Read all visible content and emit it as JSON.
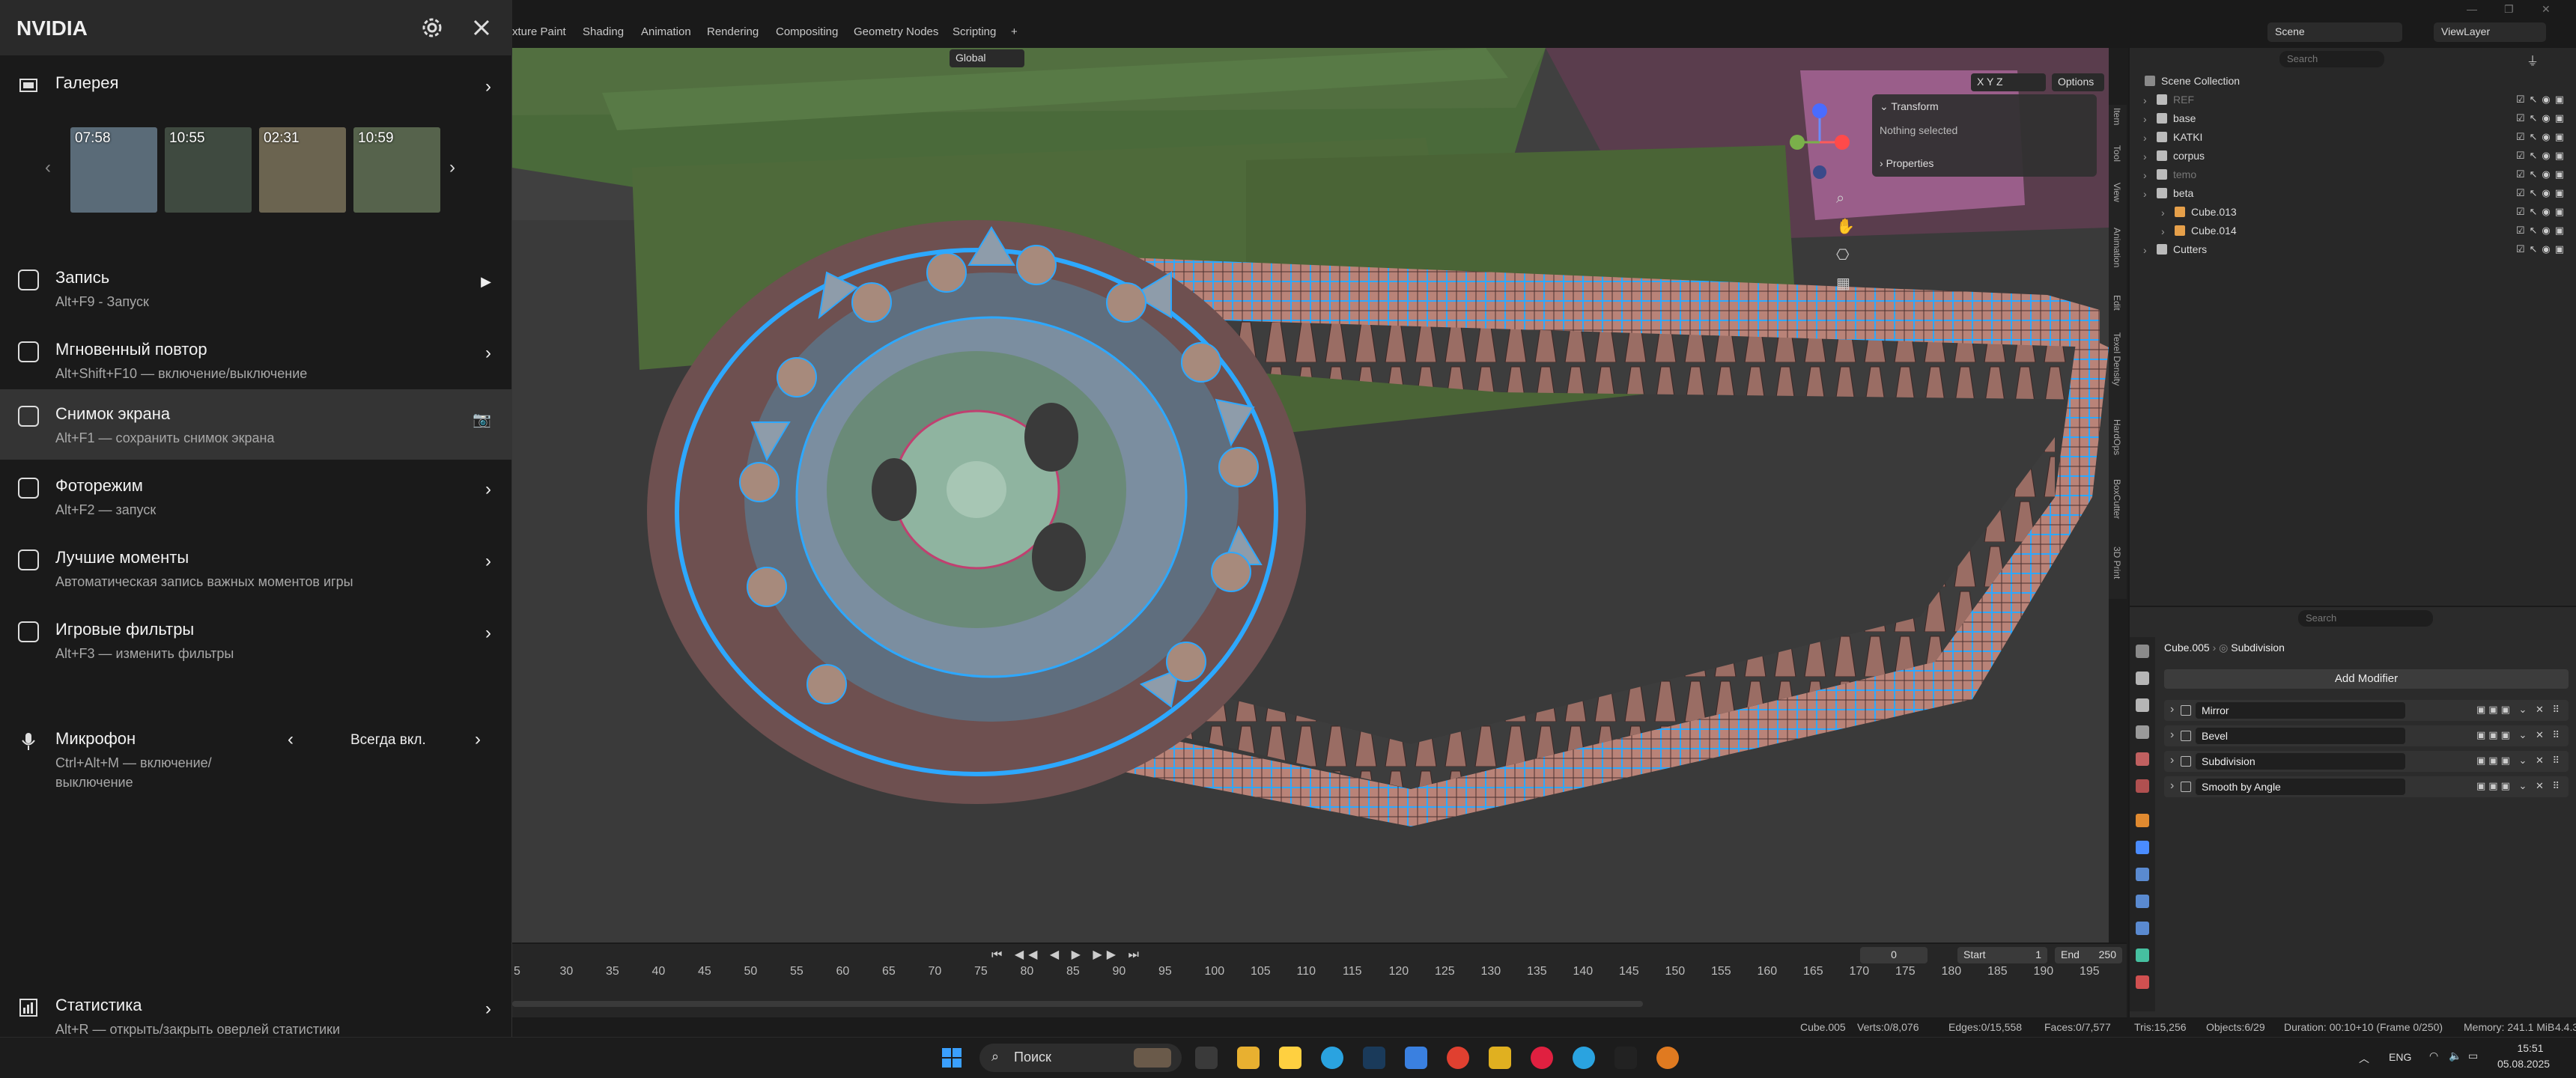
{
  "nvidia": {
    "title": "NVIDIA",
    "gallery": {
      "label": "Галерея",
      "thumbnails": [
        {
          "time": "07:58",
          "color": "#5a6b78"
        },
        {
          "time": "10:55",
          "color": "#3f4a40"
        },
        {
          "time": "02:31",
          "color": "#6b6450"
        },
        {
          "time": "10:59",
          "color": "#56634c"
        }
      ]
    },
    "items": [
      {
        "key": "record",
        "label": "Запись",
        "sub": "Alt+F9 - Запуск",
        "icon": "record-icon",
        "arrow": "▶"
      },
      {
        "key": "replay",
        "label": "Мгновенный повтор",
        "sub": "Alt+Shift+F10 — включение/выключение",
        "icon": "instant-replay-icon",
        "arrow": "›"
      },
      {
        "key": "screenshot",
        "label": "Снимок экрана",
        "sub": "Alt+F1 — сохранить снимок экрана",
        "icon": "screenshot-icon",
        "arrow": "camera"
      },
      {
        "key": "photo",
        "label": "Фоторежим",
        "sub": "Alt+F2 — запуск",
        "icon": "photo-mode-icon",
        "arrow": "›"
      },
      {
        "key": "highlights",
        "label": "Лучшие моменты",
        "sub": "Автоматическая запись важных моментов игры",
        "icon": "highlights-icon",
        "arrow": "›"
      },
      {
        "key": "filters",
        "label": "Игровые фильтры",
        "sub": "Alt+F3 — изменить фильтры",
        "icon": "game-filter-icon",
        "arrow": "›"
      }
    ],
    "microphone": {
      "label": "Микрофон",
      "sub1": "Ctrl+Alt+M — включение/",
      "sub2": "выключение",
      "value": "Всегда вкл."
    },
    "stats": {
      "label": "Статистика",
      "sub": "Alt+R — открыть/закрыть оверлей статистики"
    }
  },
  "blender": {
    "workspaces": [
      "xture Paint",
      "Shading",
      "Animation",
      "Rendering",
      "Compositing",
      "Geometry Nodes",
      "Scripting",
      "+"
    ],
    "scene": "Scene",
    "view_layer": "ViewLayer",
    "viewport": {
      "orientation": "Global",
      "options": "Options",
      "axes": "X  Y  Z",
      "transform_label": "Transform",
      "nothing_selected": "Nothing selected",
      "properties_label": "Properties",
      "side_tabs": [
        "Item",
        "Tool",
        "View",
        "Animation",
        "Edit",
        "Texel Density",
        "HardOps",
        "BoxCutter",
        "3D Print"
      ]
    },
    "outliner": {
      "search_placeholder": "Search",
      "collection": "Scene Collection",
      "rows": [
        {
          "name": "REF",
          "dim": true,
          "depth": 1
        },
        {
          "name": "base",
          "dim": false,
          "depth": 1
        },
        {
          "name": "KATKI",
          "dim": false,
          "depth": 1
        },
        {
          "name": "corpus",
          "dim": false,
          "depth": 1
        },
        {
          "name": "temo",
          "dim": true,
          "depth": 1
        },
        {
          "name": "beta",
          "dim": false,
          "depth": 1
        },
        {
          "name": "Cube.013",
          "dim": false,
          "depth": 2
        },
        {
          "name": "Cube.014",
          "dim": false,
          "depth": 2
        },
        {
          "name": "Cutters",
          "dim": false,
          "depth": 1
        }
      ]
    },
    "properties": {
      "search_placeholder": "Search",
      "object": "Cube.005",
      "modifier_context": "Subdivision",
      "add_modifier": "Add Modifier",
      "modifiers": [
        "Mirror",
        "Bevel",
        "Subdivision",
        "Smooth by Angle"
      ]
    },
    "timeline": {
      "current_frame": "0",
      "start_label": "Start",
      "start": "1",
      "end_label": "End",
      "end": "250",
      "ticks": [
        "5",
        "30",
        "35",
        "40",
        "45",
        "50",
        "55",
        "60",
        "65",
        "70",
        "75",
        "80",
        "85",
        "90",
        "95",
        "100",
        "105",
        "110",
        "115",
        "120",
        "125",
        "130",
        "135",
        "140",
        "145",
        "150",
        "155",
        "160",
        "165",
        "170",
        "175",
        "180",
        "185",
        "190",
        "195"
      ]
    },
    "status": {
      "object": "Cube.005",
      "verts": "Verts:0/8,076",
      "edges": "Edges:0/15,558",
      "faces": "Faces:0/7,577",
      "tris": "Tris:15,256",
      "objects": "Objects:6/29",
      "duration": "Duration: 00:10+10 (Frame 0/250)",
      "memory": "Memory: 241.1 MiB",
      "version": "4.4.3"
    }
  },
  "taskbar": {
    "search_label": "Поиск",
    "lang": "ENG",
    "time": "15:51",
    "date": "05.08.2025"
  },
  "colors": {
    "outliner_orange": "#e6a04a",
    "outliner_green": "#46c0a0",
    "track_pink": "#b98378",
    "wire_blue": "#2da8ff"
  }
}
